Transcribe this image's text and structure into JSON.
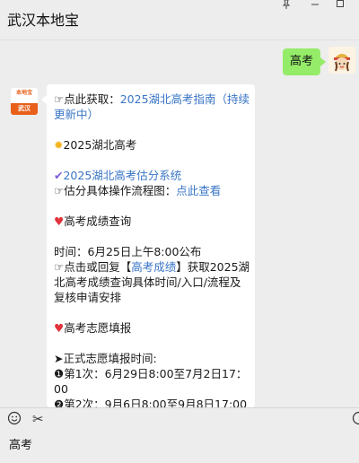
{
  "window": {
    "title": "武汉本地宝",
    "controls": [
      "pin-icon",
      "minimize-icon",
      "maximize-icon"
    ]
  },
  "messages": {
    "outgoing": {
      "text": "高考"
    },
    "incoming": {
      "avatar": {
        "brand": "本地宝",
        "city": "武汉"
      },
      "lines": {
        "l1_prefix": "☞点此获取：",
        "l1_link": "2025湖北高考指南（持续更新中）",
        "l2_icon": "sun-icon",
        "l2_text": "2025湖北高考",
        "l3_link": "2025湖北高考估分系统",
        "l4_prefix": "☞估分具体操作流程图：",
        "l4_link": "点此查看",
        "l5_text": "高考成绩查询",
        "l6_text": "时间：6月25日上午8:00公布",
        "l7_prefix": "☞点击或回复【",
        "l7_link": "高考成绩",
        "l7_suffix": "】获取2025湖北高考成绩查询具体时间/入口/流程及复核申请安排",
        "l8_text": "高考志愿填报",
        "l9_text": "➤正式志愿填报时间:",
        "l10_text": "❶第1次：6月29日8:00至7月2日17：00",
        "l11_text": "❷第2次：9月6日8:00至9月8日17:00"
      }
    }
  },
  "input": {
    "text": "高考"
  },
  "colors": {
    "background": "#ededed",
    "outgoing_bubble": "#95ec69",
    "incoming_bubble": "#ffffff",
    "link": "#3975c6",
    "heart": "#e0333a",
    "brand_orange": "#e8601a"
  }
}
